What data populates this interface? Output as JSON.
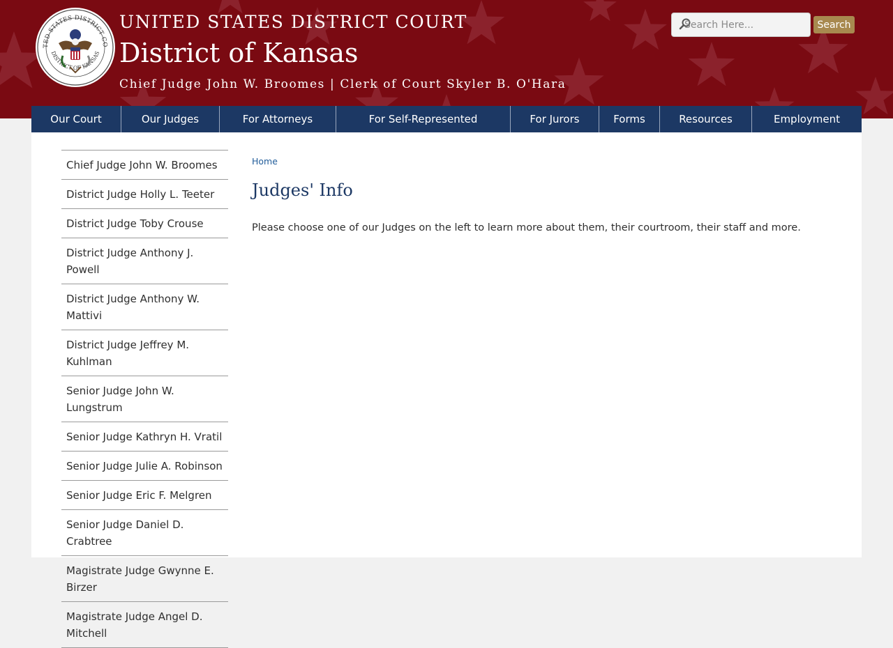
{
  "header": {
    "court_name": "UNITED STATES DISTRICT COURT",
    "district_name": "District of Kansas",
    "officers": "Chief Judge John W. Broomes | Clerk of Court Skyler B. O'Hara",
    "logo_icon": "district-court-seal-icon",
    "banner_color": "#7a0a12"
  },
  "search": {
    "placeholder": "Search Here...",
    "button_label": "Search",
    "icon": "search-icon"
  },
  "nav": {
    "items": [
      {
        "label": "Our Court"
      },
      {
        "label": "Our Judges"
      },
      {
        "label": "For Attorneys"
      },
      {
        "label": "For Self-Represented"
      },
      {
        "label": "For Jurors"
      },
      {
        "label": "Forms"
      },
      {
        "label": "Resources"
      },
      {
        "label": "Employment"
      }
    ],
    "color": "#1c3864"
  },
  "sidebar": {
    "items": [
      {
        "label": "Chief Judge John W. Broomes"
      },
      {
        "label": "District Judge Holly L. Teeter"
      },
      {
        "label": "District Judge Toby Crouse"
      },
      {
        "label": "District Judge Anthony J. Powell"
      },
      {
        "label": "District Judge Anthony W. Mattivi"
      },
      {
        "label": "District Judge Jeffrey M. Kuhlman"
      },
      {
        "label": "Senior Judge John W. Lungstrum"
      },
      {
        "label": "Senior Judge Kathryn H. Vratil"
      },
      {
        "label": "Senior Judge Julie A. Robinson"
      },
      {
        "label": "Senior Judge Eric F. Melgren"
      },
      {
        "label": "Senior Judge Daniel D. Crabtree"
      },
      {
        "label": "Magistrate Judge Gwynne E. Birzer"
      },
      {
        "label": "Magistrate Judge Angel D. Mitchell"
      }
    ]
  },
  "main": {
    "breadcrumb": "Home",
    "title": "Judges' Info",
    "intro": "Please choose one of our Judges on the left to learn more about them, their courtroom, their staff and more."
  }
}
